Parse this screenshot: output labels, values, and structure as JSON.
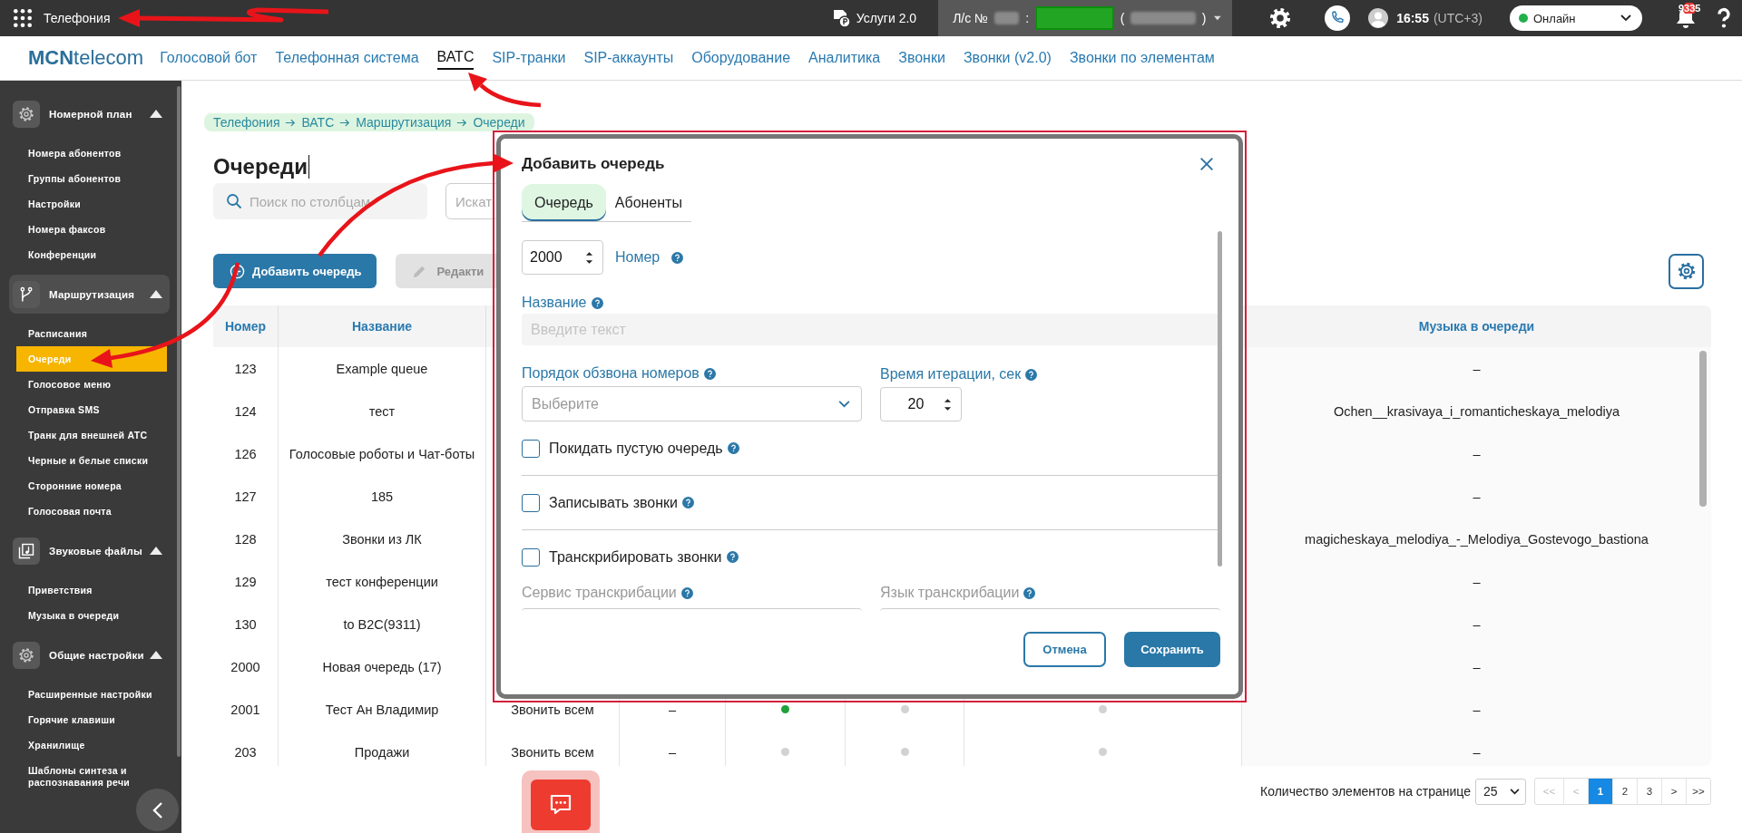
{
  "top_bar": {
    "title": "Телефония",
    "services": "Услуги 2.0",
    "account_label": "Л/с №",
    "account_separator": ":",
    "account_open": "(",
    "account_close": ")",
    "time": "16:55",
    "timezone": "(UTC+3)",
    "status": "Онлайн",
    "notifications": "9335"
  },
  "nav": {
    "logo_bold": "MCN",
    "logo_rest": "telecom",
    "items": [
      {
        "label": "Голосовой бот",
        "selected": false
      },
      {
        "label": "Телефонная система",
        "selected": false
      },
      {
        "label": "ВАТС",
        "selected": true
      },
      {
        "label": "SIP-транки",
        "selected": false
      },
      {
        "label": "SIP-аккаунты",
        "selected": false
      },
      {
        "label": "Оборудование",
        "selected": false
      },
      {
        "label": "Аналитика",
        "selected": false
      },
      {
        "label": "Звонки",
        "selected": false
      },
      {
        "label": "Звонки (v2.0)",
        "selected": false
      },
      {
        "label": "Звонки по элементам",
        "selected": false
      }
    ]
  },
  "sidebar": {
    "groups": [
      {
        "label": "Номерной план",
        "selected": false,
        "expanded": true,
        "items": [
          {
            "label": "Номера абонентов",
            "selected": false
          },
          {
            "label": "Группы абонентов",
            "selected": false
          },
          {
            "label": "Настройки",
            "selected": false
          },
          {
            "label": "Номера факсов",
            "selected": false
          },
          {
            "label": "Конференции",
            "selected": false
          }
        ]
      },
      {
        "label": "Маршрутизация",
        "selected": true,
        "expanded": true,
        "items": [
          {
            "label": "Расписания",
            "selected": false
          },
          {
            "label": "Очереди",
            "selected": true
          },
          {
            "label": "Голосовое меню",
            "selected": false
          },
          {
            "label": "Отправка SMS",
            "selected": false
          },
          {
            "label": "Транк для внешней АТС",
            "selected": false
          },
          {
            "label": "Черные и белые списки",
            "selected": false
          },
          {
            "label": "Сторонние номера",
            "selected": false
          },
          {
            "label": "Голосовая почта",
            "selected": false
          }
        ]
      },
      {
        "label": "Звуковые файлы",
        "selected": false,
        "expanded": true,
        "items": [
          {
            "label": "Приветствия",
            "selected": false
          },
          {
            "label": "Музыка в очереди",
            "selected": false
          }
        ]
      },
      {
        "label": "Общие настройки",
        "selected": false,
        "expanded": true,
        "items": [
          {
            "label": "Расширенные настройки",
            "selected": false
          },
          {
            "label": "Горячие клавиши",
            "selected": false
          },
          {
            "label": "Хранилище",
            "selected": false
          },
          {
            "label": "Шаблоны синтеза и распознавания речи",
            "selected": false
          }
        ]
      }
    ]
  },
  "breadcrumb": [
    "Телефония",
    "ВАТС",
    "Маршрутизация",
    "Очереди"
  ],
  "page_title": "Очереди",
  "search": {
    "placeholder": "Поиск по столбцам"
  },
  "search_2": {
    "placeholder": "Искат"
  },
  "toolbar": {
    "add": "Добавить очередь",
    "edit": {
      "label": "Редакти",
      "disabled": true
    }
  },
  "table": {
    "columns": [
      "Номер",
      "Название",
      "Музыка в очереди"
    ],
    "rows": [
      {
        "number": "123",
        "name": "Example queue",
        "music": "–"
      },
      {
        "number": "124",
        "name": "тест",
        "music": "Ochen__krasivaya_i_romanticheskaya_melodiya"
      },
      {
        "number": "126",
        "name": "Голосовые роботы и Чат-боты",
        "music": "–"
      },
      {
        "number": "127",
        "name": "185",
        "music": "–"
      },
      {
        "number": "128",
        "name": "Звонки из ЛК",
        "music": "magicheskaya_melodiya_-_Melodiya_Gostevogo_bastiona"
      },
      {
        "number": "129",
        "name": "тест конференции",
        "music": "–"
      },
      {
        "number": "130",
        "name": "to B2C(9311)",
        "music": "–"
      },
      {
        "number": "2000",
        "name": "Новая очередь (17)",
        "music": "–"
      },
      {
        "number": "2001",
        "name": "Тест Ан Владимир",
        "strategy": "Звонить всем",
        "column_4": "–",
        "indicators": [
          {
            "active": true
          },
          {
            "active": false
          },
          {
            "active": false
          }
        ],
        "music": "–"
      },
      {
        "number": "203",
        "name": "Продажи",
        "strategy": "Звонить всем",
        "column_4": "–",
        "indicators": [
          {
            "active": false
          },
          {
            "active": false
          },
          {
            "active": false
          }
        ],
        "music": "–"
      }
    ]
  },
  "pagination": {
    "label": "Количество элементов на странице",
    "page_size": "25",
    "pages": [
      {
        "label": "<<",
        "selected": false,
        "disabled": true
      },
      {
        "label": "<",
        "selected": false,
        "disabled": true
      },
      {
        "label": "1",
        "selected": true,
        "disabled": false
      },
      {
        "label": "2",
        "selected": false,
        "disabled": false
      },
      {
        "label": "3",
        "selected": false,
        "disabled": false
      },
      {
        "label": ">",
        "selected": false,
        "disabled": false
      },
      {
        "label": ">>",
        "selected": false,
        "disabled": false
      }
    ]
  },
  "modal": {
    "title": "Добавить очередь",
    "tabs": [
      {
        "label": "Очередь",
        "selected": true
      },
      {
        "label": "Абоненты",
        "selected": false
      }
    ],
    "number": {
      "value": "2000",
      "label": "Номер"
    },
    "name": {
      "label": "Название",
      "placeholder": "Введите текст"
    },
    "order": {
      "label": "Порядок обзвона номеров",
      "placeholder": "Выберите"
    },
    "iteration": {
      "label": "Время итерации, сек",
      "value": "20"
    },
    "checkboxes": [
      {
        "label": "Покидать пустую очередь",
        "checked": false
      },
      {
        "label": "Записывать звонки",
        "checked": false
      },
      {
        "label": "Транскрибировать звонки",
        "checked": false
      }
    ],
    "transcription_fields": [
      {
        "label": "Сервис транскрибации",
        "disabled": true
      },
      {
        "label": "Язык транскрибации",
        "disabled": true
      }
    ],
    "cancel": "Отмена",
    "save": "Сохранить"
  }
}
